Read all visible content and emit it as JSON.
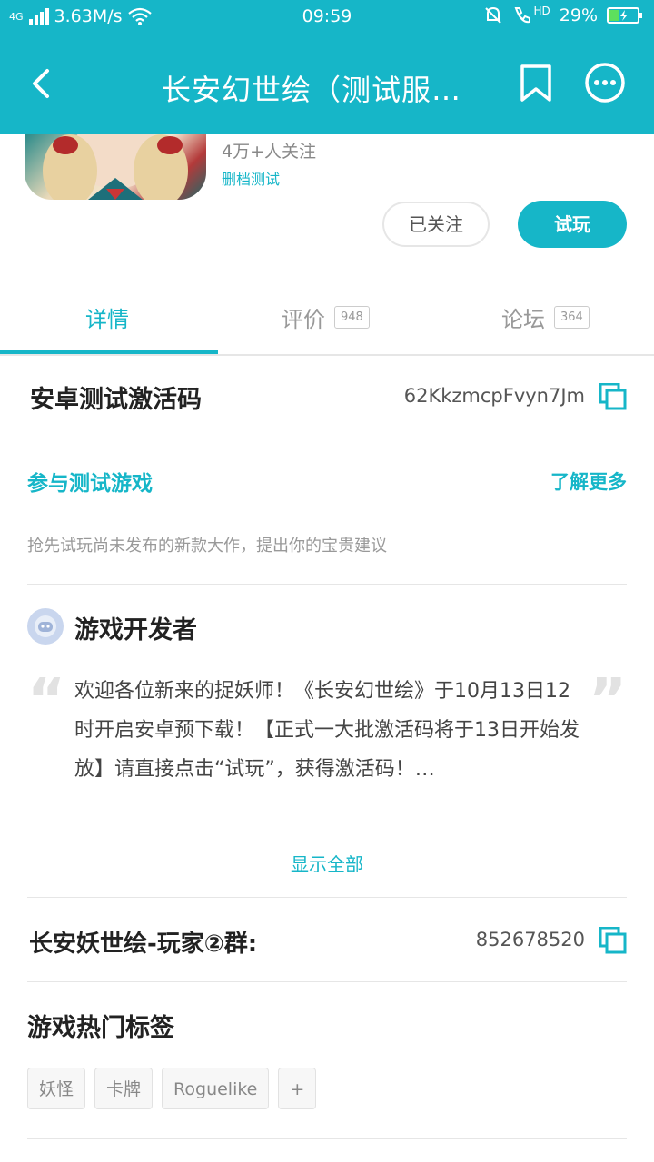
{
  "status_bar": {
    "network": "4G",
    "speed": "3.63M/s",
    "time": "09:59",
    "hd": "HD",
    "battery": "29%"
  },
  "header": {
    "title": "长安幻世绘（测试服…",
    "icons": [
      "back-icon",
      "bookmark-icon",
      "more-icon"
    ]
  },
  "game": {
    "followers": "4万+人关注",
    "status_link": "删档测试",
    "follow_button": "已关注",
    "play_button": "试玩"
  },
  "tabs": [
    {
      "label": "详情",
      "count": ""
    },
    {
      "label": "评价",
      "count": "948"
    },
    {
      "label": "论坛",
      "count": "364"
    }
  ],
  "activation": {
    "label": "安卓测试激活码",
    "code": "62KkzmcpFvyn7Jm"
  },
  "test": {
    "label": "参与测试游戏",
    "more": "了解更多",
    "description": "抢先试玩尚未发布的新款大作，提出你的宝贵建议"
  },
  "developer": {
    "title": "游戏开发者",
    "quote_open": "“",
    "quote_close": "”",
    "message": "欢迎各位新来的捉妖师！《长安幻世绘》于10月13日12时开启安卓预下载！【正式一大批激活码将于13日开始发放】请直接点击“试玩”，获得激活码！…",
    "show_all": "显示全部"
  },
  "qq_group": {
    "label": "长安妖世绘-玩家②群:",
    "number": "852678520"
  },
  "tags": {
    "title": "游戏热门标签",
    "items": [
      "妖怪",
      "卡牌",
      "Roguelike",
      "+"
    ]
  },
  "colors": {
    "accent": "#16b6c8"
  }
}
